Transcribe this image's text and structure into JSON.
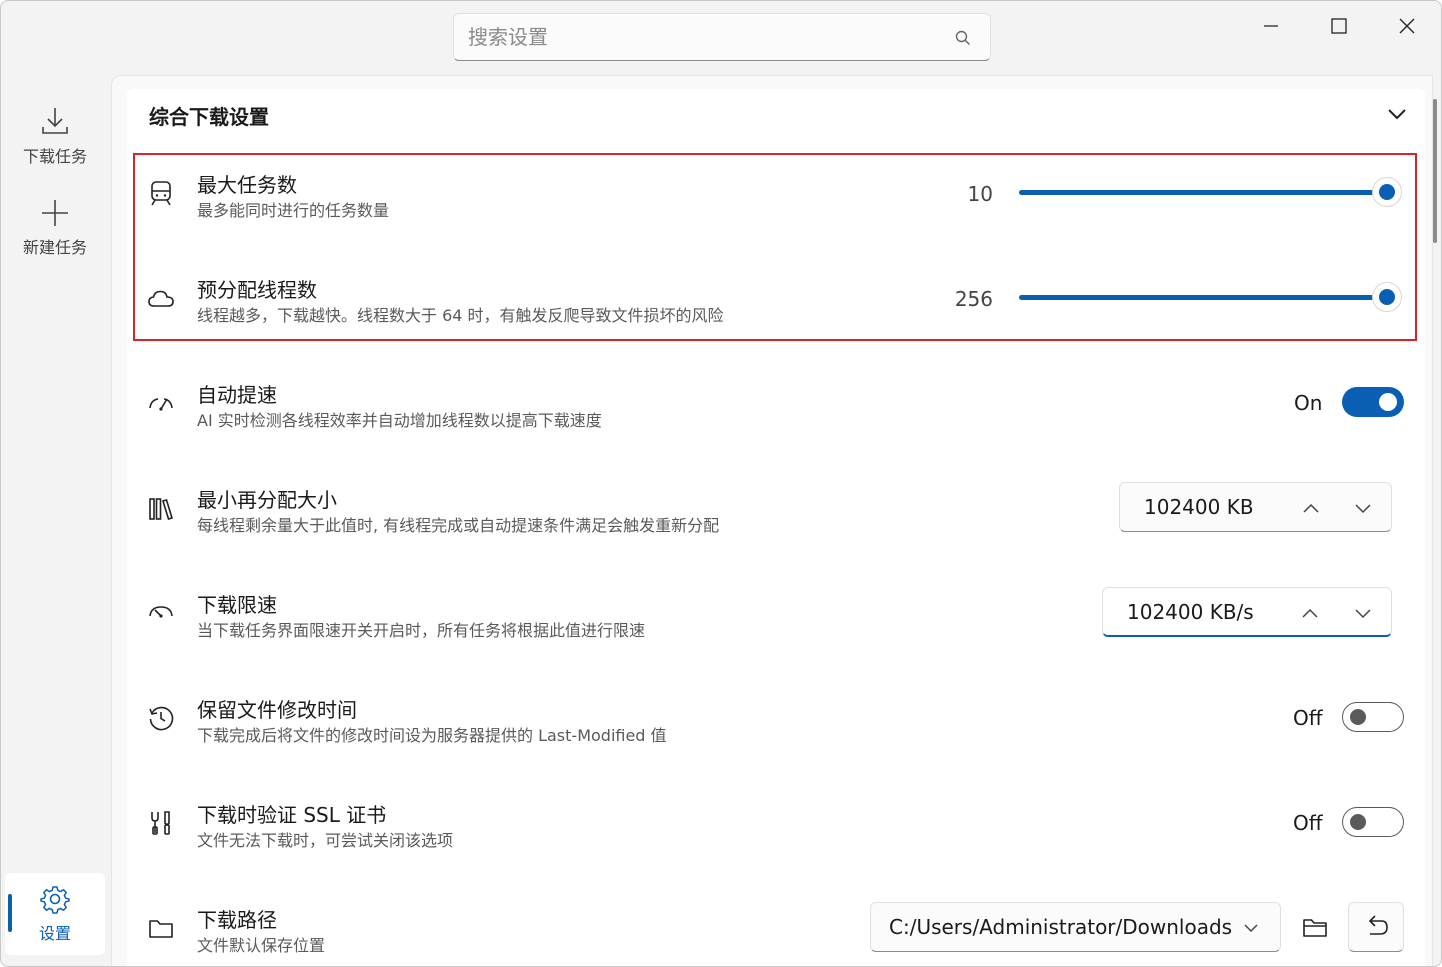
{
  "search": {
    "placeholder": "搜索设置"
  },
  "nav": {
    "download_tasks": "下载任务",
    "new_task": "新建任务",
    "settings": "设置"
  },
  "section": {
    "title": "综合下载设置"
  },
  "settings": {
    "max_tasks": {
      "title": "最大任务数",
      "desc": "最多能同时进行的任务数量",
      "value": "10",
      "level": 1.0
    },
    "prealloc_threads": {
      "title": "预分配线程数",
      "desc": "线程越多，下载越快。线程数大于 64 时，有触发反爬导致文件损坏的风险",
      "value": "256",
      "level": 1.0
    },
    "auto_speedup": {
      "title": "自动提速",
      "desc": "AI 实时检测各线程效率并自动增加线程数以提高下载速度",
      "state": "On"
    },
    "min_realloc": {
      "title": "最小再分配大小",
      "desc": "每线程剩余量大于此值时, 有线程完成或自动提速条件满足会触发重新分配",
      "value": "102400 KB"
    },
    "speed_limit": {
      "title": "下载限速",
      "desc": "当下载任务界面限速开关开启时，所有任务将根据此值进行限速",
      "value": "102400 KB/s"
    },
    "keep_mtime": {
      "title": "保留文件修改时间",
      "desc": "下载完成后将文件的修改时间设为服务器提供的 Last-Modified 值",
      "state": "Off"
    },
    "verify_ssl": {
      "title": "下载时验证 SSL 证书",
      "desc": "文件无法下载时，可尝试关闭该选项",
      "state": "Off"
    },
    "download_path": {
      "title": "下载路径",
      "desc": "文件默认保存位置",
      "value": "C:/Users/Administrator/Downloads"
    }
  },
  "colors": {
    "accent": "#0a5fb4",
    "highlight_border": "#d8232a"
  }
}
